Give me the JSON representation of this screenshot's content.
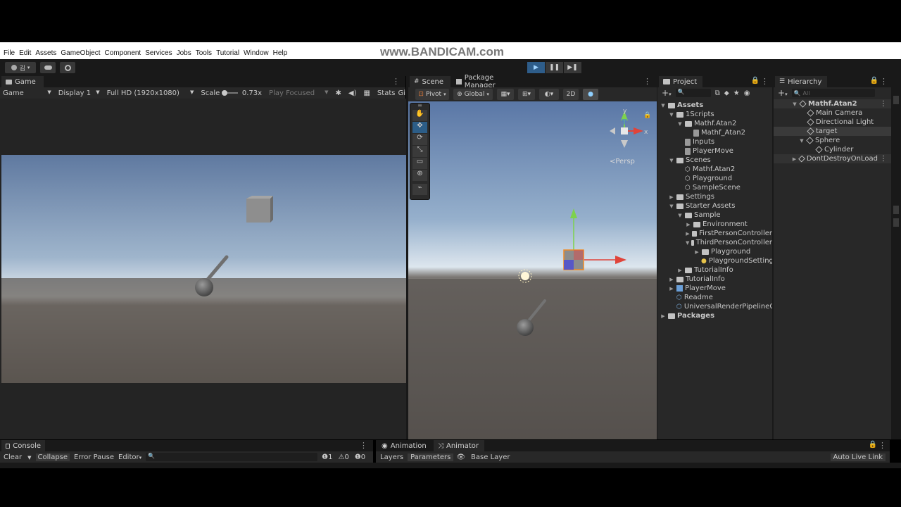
{
  "watermark": {
    "text": "www.BANDICAM.com"
  },
  "menu": [
    "File",
    "Edit",
    "Assets",
    "GameObject",
    "Component",
    "Services",
    "Jobs",
    "Tools",
    "Tutorial",
    "Window",
    "Help"
  ],
  "main_toolbar": {
    "account_label": "김"
  },
  "game_panel": {
    "tab": "Game",
    "mode": "Game",
    "display": "Display 1",
    "resolution": "Full HD (1920x1080)",
    "scale_label": "Scale",
    "scale_value": "0.73x",
    "play_focused": "Play Focused",
    "stats": "Stats",
    "gizmos": "Gi"
  },
  "scene_panel": {
    "tab_scene": "Scene",
    "tab_package_manager": "Package Manager",
    "pivot": "Pivot",
    "global": "Global",
    "mode_2d": "2D",
    "persp": "<Persp",
    "gizmo_x": "x",
    "gizmo_y": "y"
  },
  "project_panel": {
    "tab": "Project",
    "items": [
      {
        "label": "Assets",
        "bold": true
      },
      {
        "label": "1Scripts"
      },
      {
        "label": "Mathf.Atan2"
      },
      {
        "label": "Mathf_Atan2"
      },
      {
        "label": "Inputs"
      },
      {
        "label": "PlayerMove"
      },
      {
        "label": "Scenes"
      },
      {
        "label": "Mathf.Atan2"
      },
      {
        "label": "Playground"
      },
      {
        "label": "SampleScene"
      },
      {
        "label": "Settings"
      },
      {
        "label": "Starter Assets"
      },
      {
        "label": "Sample"
      },
      {
        "label": "Environment"
      },
      {
        "label": "FirstPersonController"
      },
      {
        "label": "ThirdPersonController"
      },
      {
        "label": "Playground"
      },
      {
        "label": "PlaygroundSettings"
      },
      {
        "label": "TutorialInfo"
      },
      {
        "label": "TutorialInfo"
      },
      {
        "label": "PlayerMove"
      },
      {
        "label": "Readme"
      },
      {
        "label": "UniversalRenderPipelineGl"
      },
      {
        "label": "Packages",
        "bold": true
      }
    ]
  },
  "hierarchy_panel": {
    "tab": "Hierarchy",
    "search_placeholder": "All",
    "items": [
      {
        "label": "Mathf.Atan2"
      },
      {
        "label": "Main Camera"
      },
      {
        "label": "Directional Light"
      },
      {
        "label": "target",
        "selected": true
      },
      {
        "label": "Sphere"
      },
      {
        "label": "Cylinder"
      },
      {
        "label": "DontDestroyOnLoad"
      }
    ]
  },
  "console_panel": {
    "tab": "Console",
    "clear": "Clear",
    "collapse": "Collapse",
    "error_pause": "Error Pause",
    "editor": "Editor",
    "count_errors": "1",
    "count_warnings": "0",
    "count_messages": "0"
  },
  "animator_panel": {
    "tab_animation": "Animation",
    "tab_animator": "Animator",
    "layers": "Layers",
    "parameters": "Parameters",
    "base_layer": "Base Layer",
    "auto_live_link": "Auto Live Link"
  },
  "colors": {
    "editor_bg": "#282828",
    "toolbar_bg": "#191919",
    "selection": "#2c5d87",
    "play_active": "#2e5d8a",
    "axis_x": "#e0443a",
    "axis_y": "#7dd24c",
    "axis_z": "#4a7bd6"
  }
}
